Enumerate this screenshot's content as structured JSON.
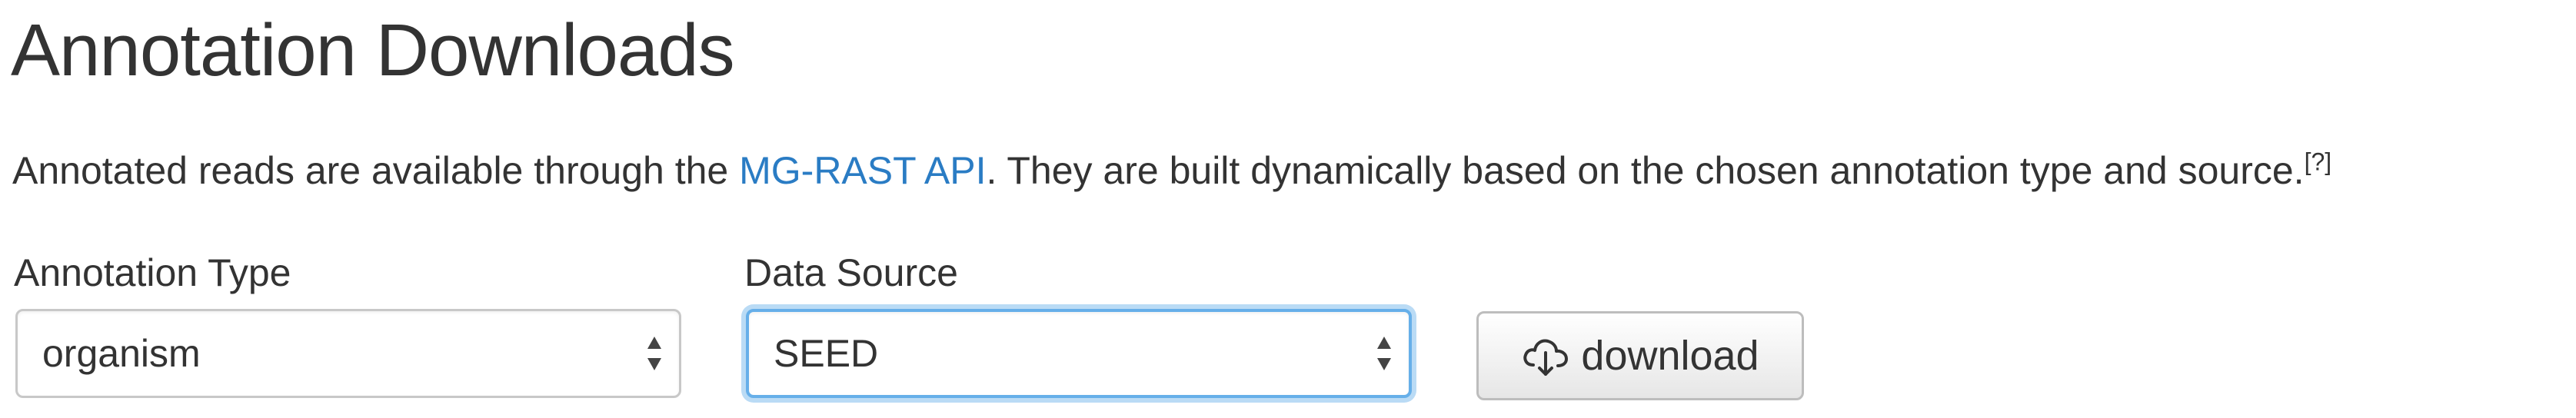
{
  "header": {
    "title": "Annotation Downloads"
  },
  "intro": {
    "text_before_link": "Annotated reads are available through the ",
    "link_text": "MG-RAST API",
    "text_after_link": ". They are built dynamically based on the chosen annotation type and source.",
    "help_marker": "[?]"
  },
  "form": {
    "annotation_type": {
      "label": "Annotation Type",
      "value": "organism"
    },
    "data_source": {
      "label": "Data Source",
      "value": "SEED"
    },
    "download_button": {
      "label": "download",
      "icon": "cloud-download-icon"
    }
  },
  "colors": {
    "link": "#2a7cc4",
    "focus_ring": "#66afe9"
  }
}
